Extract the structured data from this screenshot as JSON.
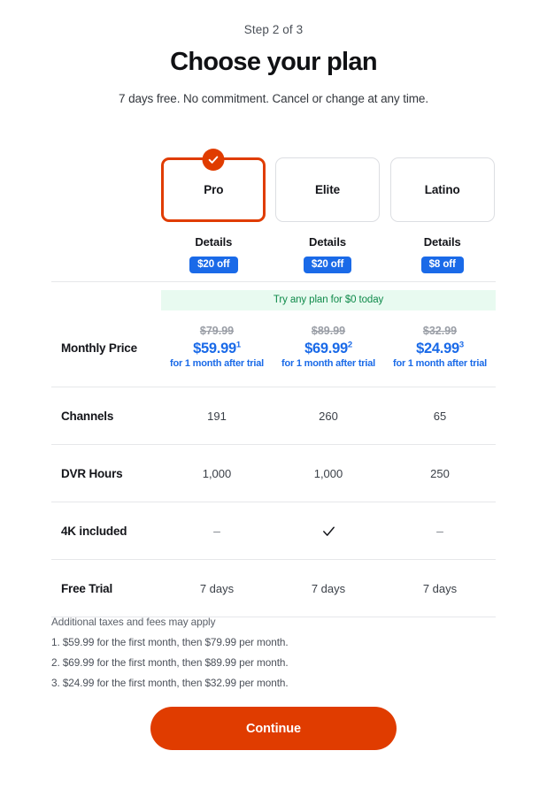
{
  "header": {
    "step_label": "Step 2 of 3",
    "title": "Choose your plan",
    "subtitle": "7 days free. No commitment. Cancel or change at any time."
  },
  "plans": [
    {
      "name": "Pro",
      "selected": true,
      "details_label": "Details",
      "discount_badge": "$20 off"
    },
    {
      "name": "Elite",
      "selected": false,
      "details_label": "Details",
      "discount_badge": "$20 off"
    },
    {
      "name": "Latino",
      "selected": false,
      "details_label": "Details",
      "discount_badge": "$8 off"
    }
  ],
  "promo_banner": "Try any plan for $0 today",
  "table": {
    "price_row": {
      "label": "Monthly Price",
      "cells": [
        {
          "old_price": "$79.99",
          "new_price": "$59.99",
          "footnote_marker": "1",
          "note": "for 1 month after trial"
        },
        {
          "old_price": "$89.99",
          "new_price": "$69.99",
          "footnote_marker": "2",
          "note": "for 1 month after trial"
        },
        {
          "old_price": "$32.99",
          "new_price": "$24.99",
          "footnote_marker": "3",
          "note": "for 1 month after trial"
        }
      ]
    },
    "feature_rows": [
      {
        "label": "Channels",
        "values": [
          "191",
          "260",
          "65"
        ],
        "types": [
          "text",
          "text",
          "text"
        ]
      },
      {
        "label": "DVR Hours",
        "values": [
          "1,000",
          "1,000",
          "250"
        ],
        "types": [
          "text",
          "text",
          "text"
        ]
      },
      {
        "label": "4K included",
        "values": [
          "–",
          "",
          "–"
        ],
        "types": [
          "dash",
          "check",
          "dash"
        ]
      },
      {
        "label": "Free Trial",
        "values": [
          "7 days",
          "7 days",
          "7 days"
        ],
        "types": [
          "text",
          "text",
          "text"
        ]
      }
    ]
  },
  "footnotes": [
    "Additional taxes and fees may apply",
    "1. $59.99 for the first month, then $79.99 per month.",
    "2. $69.99 for the first month, then $89.99 per month.",
    "3. $24.99 for the first month, then $32.99 per month."
  ],
  "continue_button": "Continue",
  "colors": {
    "brand_orange": "#e03c00",
    "badge_blue": "#1a6ae8",
    "promo_green_bg": "#e8faf0",
    "promo_green_text": "#0f8a4a",
    "divider": "#e6e7ea"
  }
}
